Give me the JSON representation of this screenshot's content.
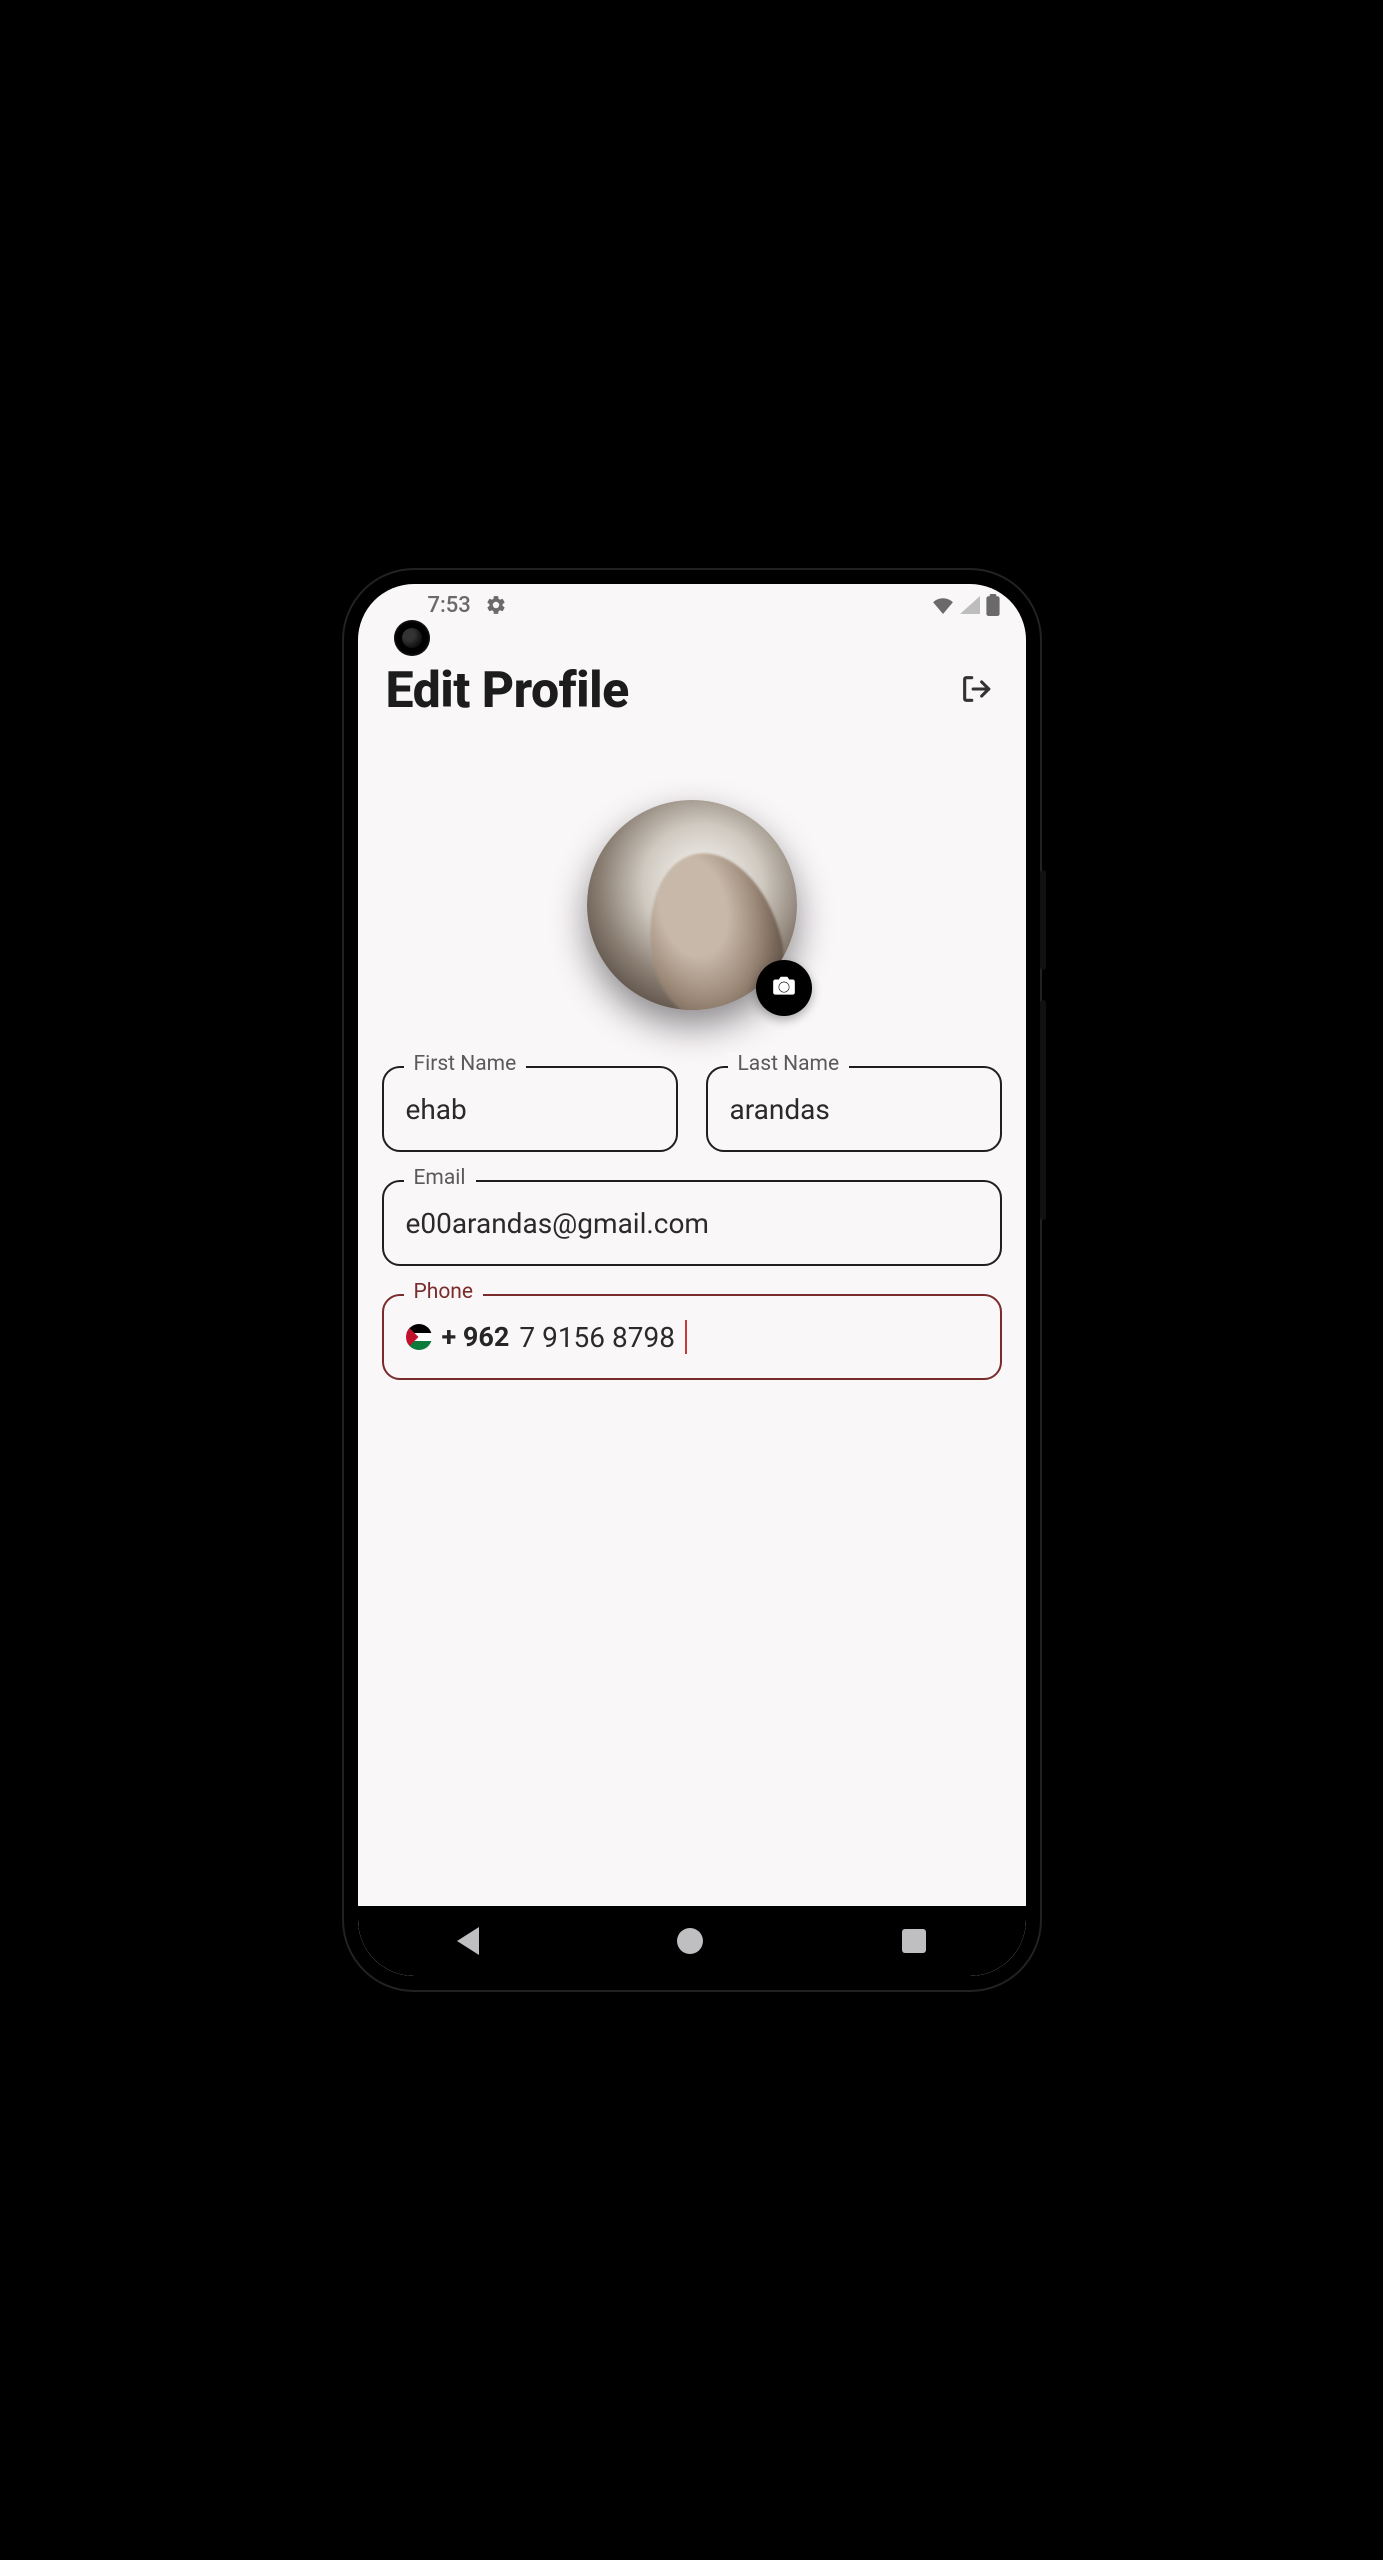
{
  "status": {
    "time": "7:53",
    "gear_icon": "gear-icon",
    "wifi_icon": "wifi-icon",
    "signal_icon": "cellular-signal-icon",
    "battery_icon": "battery-icon"
  },
  "header": {
    "title": "Edit Profile",
    "logout_icon": "logout-icon"
  },
  "avatar": {
    "camera_icon": "camera-icon"
  },
  "form": {
    "first_name": {
      "label": "First Name",
      "value": "ehab"
    },
    "last_name": {
      "label": "Last Name",
      "value": "arandas"
    },
    "email": {
      "label": "Email",
      "value": "e00arandas@gmail.com"
    },
    "phone": {
      "label": "Phone",
      "country_code": "+ 962",
      "value": "7 9156 8798",
      "flag": "jordan-flag"
    }
  },
  "navbar": {
    "back_icon": "triangle-back-icon",
    "home_icon": "circle-home-icon",
    "recents_icon": "square-recents-icon"
  }
}
